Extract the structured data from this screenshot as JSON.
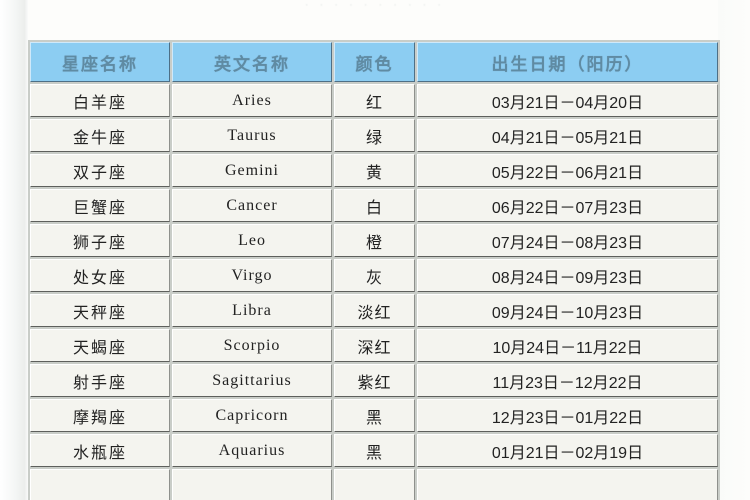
{
  "page": {
    "top_remnant_text": "· · · · ·      · ·      · · ·",
    "background_color": "#fdfdfb"
  },
  "table": {
    "name": "zodiac-sign-table",
    "header_background": "#8ccdf2",
    "header_text_color": "#5f8ba3",
    "cell_background": "#f4f4ef",
    "columns": [
      {
        "key": "name",
        "label": "星座名称"
      },
      {
        "key": "eng",
        "label": "英文名称"
      },
      {
        "key": "color",
        "label": "颜色"
      },
      {
        "key": "date",
        "label": "出生日期（阳历）"
      }
    ],
    "rows": [
      {
        "name": "白羊座",
        "eng": "Aries",
        "color": "红",
        "date": "03月21日－04月20日"
      },
      {
        "name": "金牛座",
        "eng": "Taurus",
        "color": "绿",
        "date": "04月21日－05月21日"
      },
      {
        "name": "双子座",
        "eng": "Gemini",
        "color": "黄",
        "date": "05月22日－06月21日"
      },
      {
        "name": "巨蟹座",
        "eng": "Cancer",
        "color": "白",
        "date": "06月22日－07月23日"
      },
      {
        "name": "狮子座",
        "eng": "Leo",
        "color": "橙",
        "date": "07月24日－08月23日"
      },
      {
        "name": "处女座",
        "eng": "Virgo",
        "color": "灰",
        "date": "08月24日－09月23日"
      },
      {
        "name": "天秤座",
        "eng": "Libra",
        "color": "淡红",
        "date": "09月24日－10月23日"
      },
      {
        "name": "天蝎座",
        "eng": "Scorpio",
        "color": "深红",
        "date": "10月24日－11月22日"
      },
      {
        "name": "射手座",
        "eng": "Sagittarius",
        "color": "紫红",
        "date": "11月23日－12月22日"
      },
      {
        "name": "摩羯座",
        "eng": "Capricorn",
        "color": "黑",
        "date": "12月23日－01月22日"
      },
      {
        "name": "水瓶座",
        "eng": "Aquarius",
        "color": "黑",
        "date": "01月21日－02月19日"
      }
    ]
  }
}
